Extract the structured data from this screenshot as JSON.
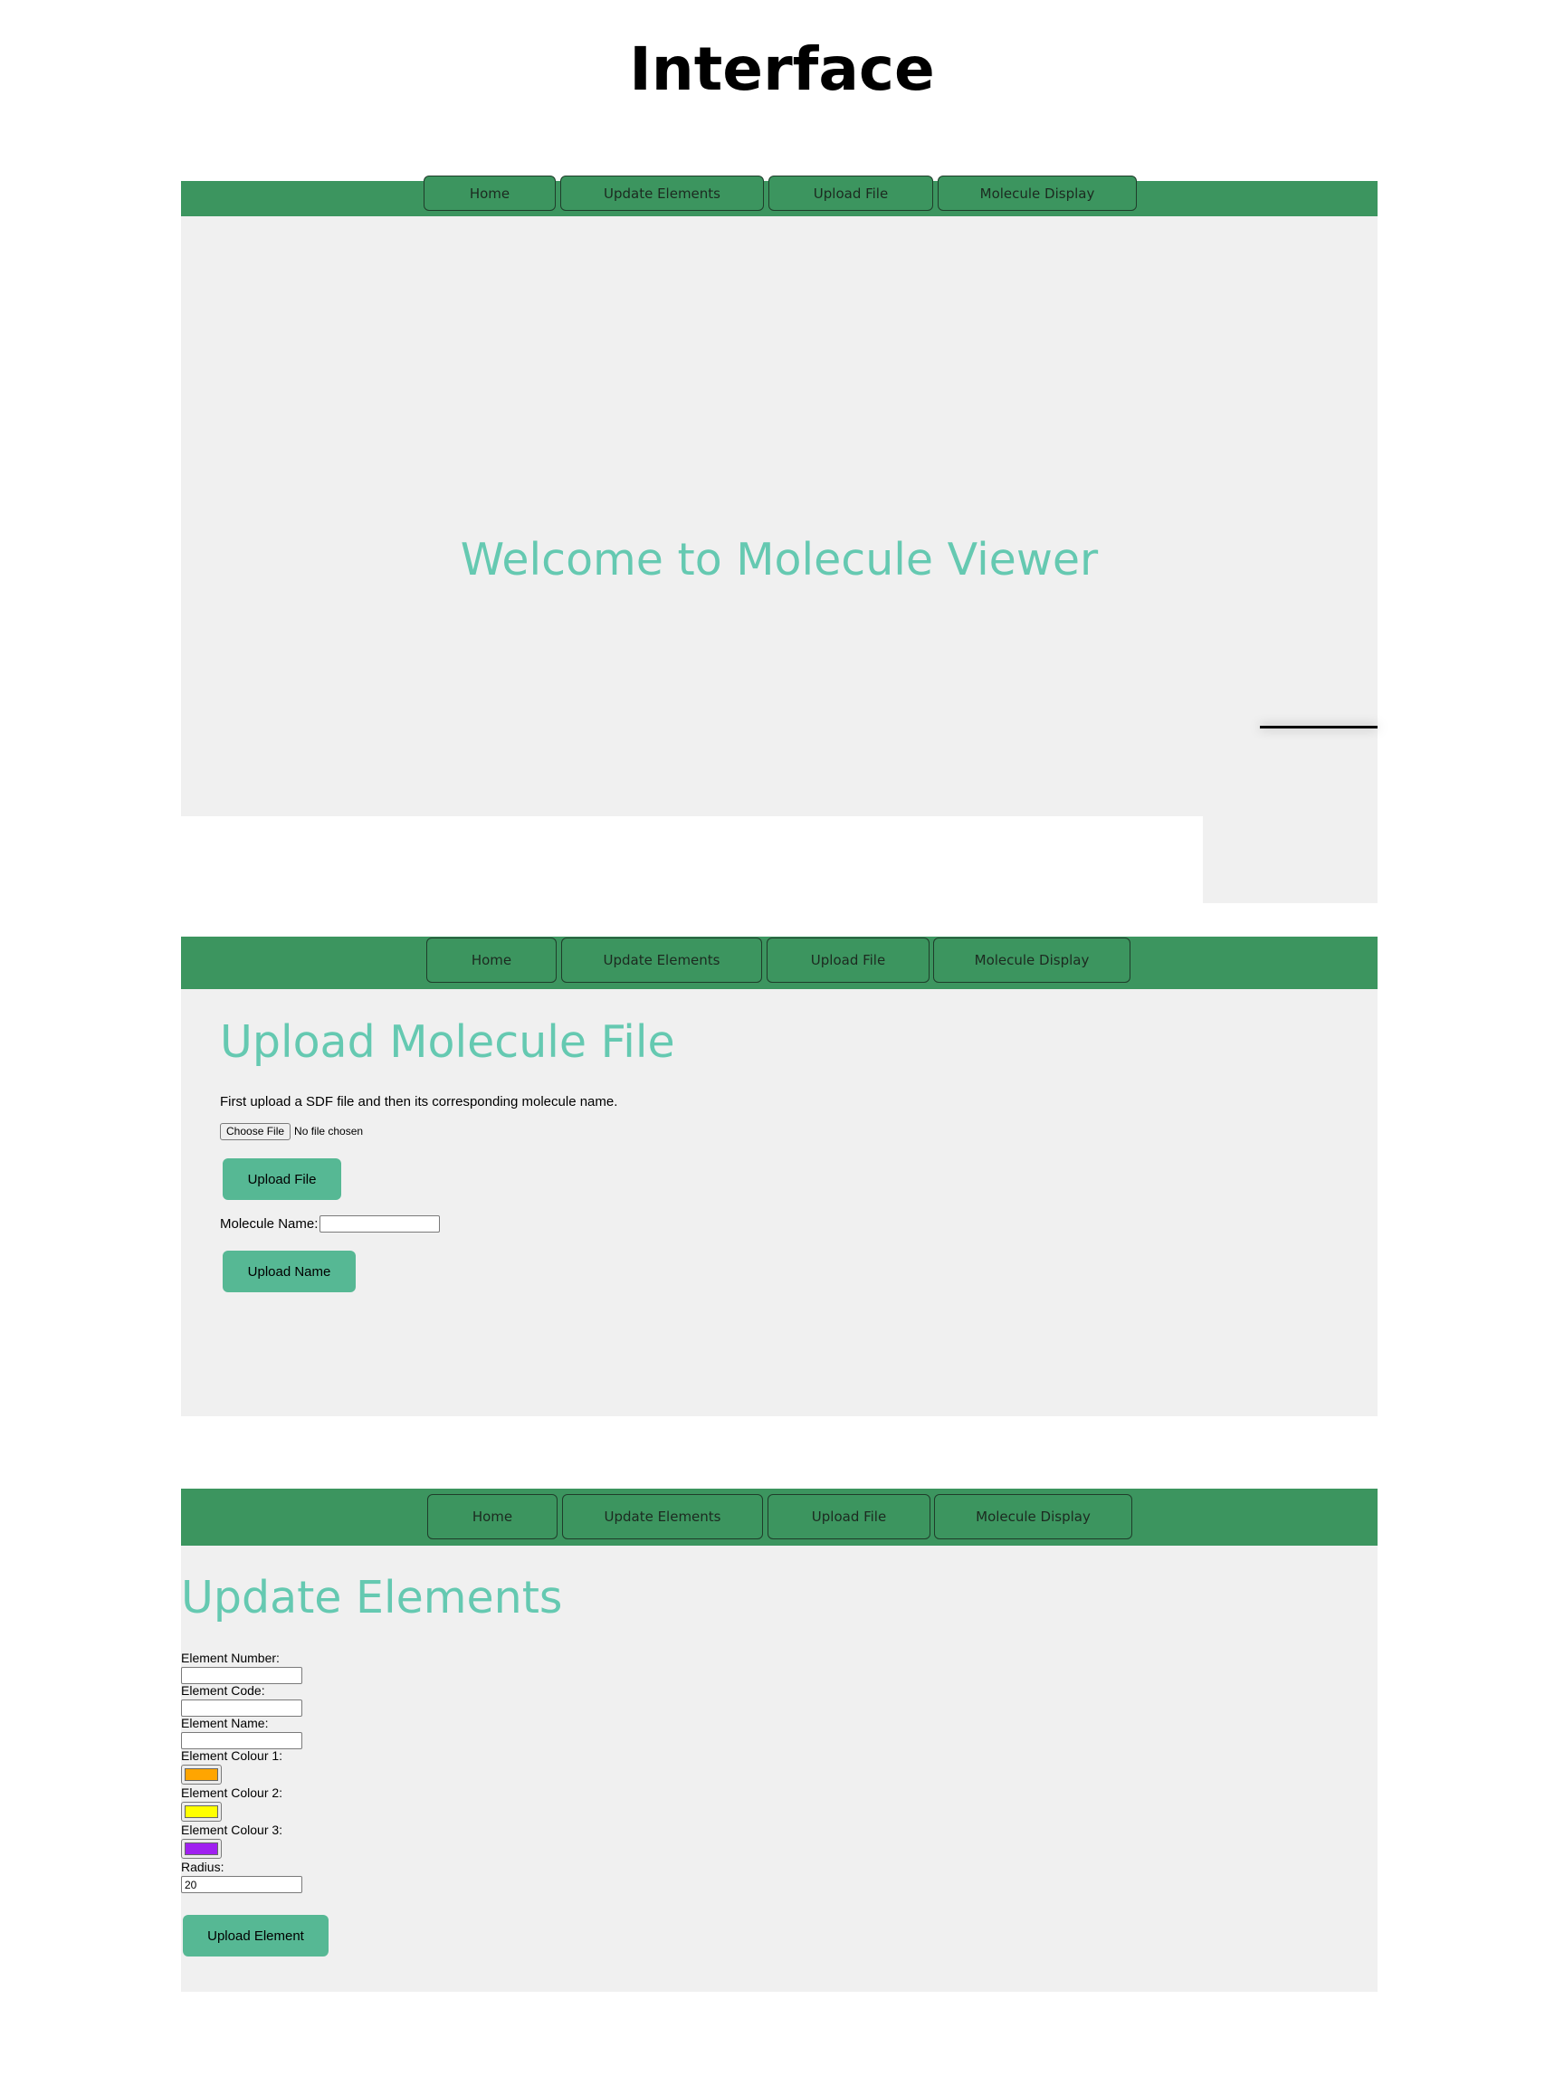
{
  "page": {
    "title": "Interface"
  },
  "nav": {
    "home": "Home",
    "update_elements": "Update Elements",
    "upload_file": "Upload File",
    "molecule_display": "Molecule Display"
  },
  "home_screen": {
    "heading": "Welcome to Molecule Viewer"
  },
  "upload_screen": {
    "heading": "Upload Molecule File",
    "instructions": "First upload a SDF file and then its corresponding molecule name.",
    "choose_file_label": "Choose File",
    "no_file_text": "No file chosen",
    "upload_file_button": "Upload File",
    "molecule_name_label": "Molecule Name:",
    "molecule_name_value": "",
    "upload_name_button": "Upload Name"
  },
  "update_screen": {
    "heading": "Update Elements",
    "element_number_label": "Element Number:",
    "element_number_value": "",
    "element_code_label": "Element Code:",
    "element_code_value": "",
    "element_name_label": "Element Name:",
    "element_name_value": "",
    "colour1_label": "Element Colour 1:",
    "colour1_value": "#ffa500",
    "colour2_label": "Element Colour 2:",
    "colour2_value": "#ffff00",
    "colour3_label": "Element Colour 3:",
    "colour3_value": "#a020f0",
    "radius_label": "Radius:",
    "radius_value": "20",
    "upload_element_button": "Upload Element"
  },
  "colors": {
    "nav_bg": "#3c955f",
    "heading": "#65c9b1",
    "button": "#56b894",
    "panel_bg": "#f0f0f0"
  }
}
